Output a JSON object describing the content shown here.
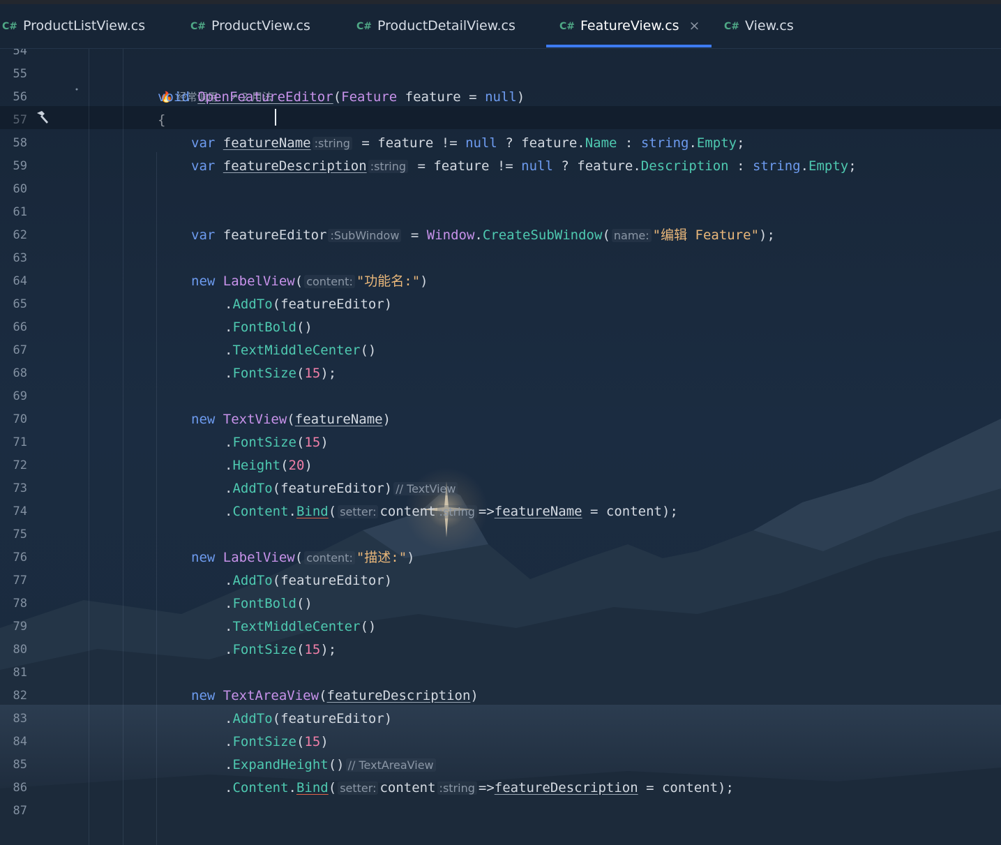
{
  "tabs": [
    {
      "icon": "C#",
      "label": "ProductListView.cs",
      "active": false
    },
    {
      "icon": "C#",
      "label": "ProductView.cs",
      "active": false
    },
    {
      "icon": "C#",
      "label": "ProductDetailView.cs",
      "active": false
    },
    {
      "icon": "C#",
      "label": "FeatureView.cs",
      "active": true,
      "close": "×"
    },
    {
      "icon": "C#",
      "label": "View.cs",
      "active": false
    }
  ],
  "editor": {
    "codelens": {
      "usage_hint": "经常调用",
      "usages": "2 用法"
    },
    "line_numbers": [
      "54",
      "55",
      "56",
      "57",
      "58",
      "59",
      "60",
      "61",
      "62",
      "63",
      "64",
      "65",
      "66",
      "67",
      "68",
      "69",
      "70",
      "71",
      "72",
      "73",
      "74",
      "75",
      "76",
      "77",
      "78",
      "79",
      "80",
      "81",
      "82",
      "83",
      "84",
      "85",
      "86",
      "87"
    ],
    "lines": [
      {
        "line": 56,
        "indent": 0,
        "tokens": [
          {
            "t": "void",
            "c": "kw"
          },
          {
            "t": " "
          },
          {
            "t": "OpenFeatureEditor",
            "c": "fn und"
          },
          {
            "t": "("
          },
          {
            "t": "Feature",
            "c": "typ"
          },
          {
            "t": " feature = "
          },
          {
            "t": "null",
            "c": "kw"
          },
          {
            "t": ")"
          }
        ]
      },
      {
        "line": 57,
        "indent": 0,
        "tokens": [
          {
            "t": "{"
          }
        ]
      },
      {
        "line": 58,
        "indent": 1,
        "tokens": [
          {
            "t": "var",
            "c": "kw"
          },
          {
            "t": " "
          },
          {
            "t": "featureName",
            "c": "und"
          },
          {
            "t": ":string",
            "c": "hint"
          },
          {
            "t": " = feature != "
          },
          {
            "t": "null",
            "c": "kw"
          },
          {
            "t": " ? feature."
          },
          {
            "t": "Name",
            "c": "prop"
          },
          {
            "t": " : "
          },
          {
            "t": "string",
            "c": "kw"
          },
          {
            "t": "."
          },
          {
            "t": "Empty",
            "c": "prop"
          },
          {
            "t": ";"
          }
        ]
      },
      {
        "line": 59,
        "indent": 1,
        "tokens": [
          {
            "t": "var",
            "c": "kw"
          },
          {
            "t": " "
          },
          {
            "t": "featureDescription",
            "c": "und"
          },
          {
            "t": ":string",
            "c": "hint"
          },
          {
            "t": " = feature != "
          },
          {
            "t": "null",
            "c": "kw"
          },
          {
            "t": " ? feature."
          },
          {
            "t": "Description",
            "c": "prop"
          },
          {
            "t": " : "
          },
          {
            "t": "string",
            "c": "kw"
          },
          {
            "t": "."
          },
          {
            "t": "Empty",
            "c": "prop"
          },
          {
            "t": ";"
          }
        ]
      },
      {
        "line": 62,
        "indent": 1,
        "tokens": [
          {
            "t": "var",
            "c": "kw"
          },
          {
            "t": " featureEditor"
          },
          {
            "t": ":SubWindow",
            "c": "hint"
          },
          {
            "t": " = "
          },
          {
            "t": "Window",
            "c": "typ"
          },
          {
            "t": "."
          },
          {
            "t": "CreateSubWindow",
            "c": "meth"
          },
          {
            "t": "("
          },
          {
            "t": "name:",
            "c": "hint"
          },
          {
            "t": "\"编辑 Feature\"",
            "c": "str"
          },
          {
            "t": ");"
          }
        ]
      },
      {
        "line": 64,
        "indent": 1,
        "tokens": [
          {
            "t": "new",
            "c": "kw"
          },
          {
            "t": " "
          },
          {
            "t": "LabelView",
            "c": "typ"
          },
          {
            "t": "("
          },
          {
            "t": "content:",
            "c": "hint"
          },
          {
            "t": "\"功能名:\"",
            "c": "str"
          },
          {
            "t": ")"
          }
        ]
      },
      {
        "line": 65,
        "indent": 2,
        "tokens": [
          {
            "t": "."
          },
          {
            "t": "AddTo",
            "c": "meth"
          },
          {
            "t": "(featureEditor)"
          }
        ]
      },
      {
        "line": 66,
        "indent": 2,
        "tokens": [
          {
            "t": "."
          },
          {
            "t": "FontBold",
            "c": "meth"
          },
          {
            "t": "()"
          }
        ]
      },
      {
        "line": 67,
        "indent": 2,
        "tokens": [
          {
            "t": "."
          },
          {
            "t": "TextMiddleCenter",
            "c": "meth"
          },
          {
            "t": "()"
          }
        ]
      },
      {
        "line": 68,
        "indent": 2,
        "tokens": [
          {
            "t": "."
          },
          {
            "t": "FontSize",
            "c": "meth"
          },
          {
            "t": "("
          },
          {
            "t": "15",
            "c": "num"
          },
          {
            "t": ");"
          }
        ]
      },
      {
        "line": 70,
        "indent": 1,
        "tokens": [
          {
            "t": "new",
            "c": "kw"
          },
          {
            "t": " "
          },
          {
            "t": "TextView",
            "c": "typ"
          },
          {
            "t": "("
          },
          {
            "t": "featureName",
            "c": "und"
          },
          {
            "t": ")"
          }
        ]
      },
      {
        "line": 71,
        "indent": 2,
        "tokens": [
          {
            "t": "."
          },
          {
            "t": "FontSize",
            "c": "meth"
          },
          {
            "t": "("
          },
          {
            "t": "15",
            "c": "num"
          },
          {
            "t": ")"
          }
        ]
      },
      {
        "line": 72,
        "indent": 2,
        "tokens": [
          {
            "t": "."
          },
          {
            "t": "Height",
            "c": "meth"
          },
          {
            "t": "("
          },
          {
            "t": "20",
            "c": "num"
          },
          {
            "t": ")"
          }
        ]
      },
      {
        "line": 73,
        "indent": 2,
        "tokens": [
          {
            "t": "."
          },
          {
            "t": "AddTo",
            "c": "meth"
          },
          {
            "t": "(featureEditor)"
          },
          {
            "t": "// TextView",
            "c": "hint"
          }
        ]
      },
      {
        "line": 74,
        "indent": 2,
        "tokens": [
          {
            "t": "."
          },
          {
            "t": "Content",
            "c": "prop"
          },
          {
            "t": "."
          },
          {
            "t": "Bind",
            "c": "meth red-und"
          },
          {
            "t": "("
          },
          {
            "t": "setter:",
            "c": "hint"
          },
          {
            "t": "content"
          },
          {
            "t": ":string",
            "c": "hint"
          },
          {
            "t": "=>"
          },
          {
            "t": "featureName",
            "c": "und"
          },
          {
            "t": " = content);"
          }
        ]
      },
      {
        "line": 76,
        "indent": 1,
        "tokens": [
          {
            "t": "new",
            "c": "kw"
          },
          {
            "t": " "
          },
          {
            "t": "LabelView",
            "c": "typ"
          },
          {
            "t": "("
          },
          {
            "t": "content:",
            "c": "hint"
          },
          {
            "t": "\"描述:\"",
            "c": "str"
          },
          {
            "t": ")"
          }
        ]
      },
      {
        "line": 77,
        "indent": 2,
        "tokens": [
          {
            "t": "."
          },
          {
            "t": "AddTo",
            "c": "meth"
          },
          {
            "t": "(featureEditor)"
          }
        ]
      },
      {
        "line": 78,
        "indent": 2,
        "tokens": [
          {
            "t": "."
          },
          {
            "t": "FontBold",
            "c": "meth"
          },
          {
            "t": "()"
          }
        ]
      },
      {
        "line": 79,
        "indent": 2,
        "tokens": [
          {
            "t": "."
          },
          {
            "t": "TextMiddleCenter",
            "c": "meth"
          },
          {
            "t": "()"
          }
        ]
      },
      {
        "line": 80,
        "indent": 2,
        "tokens": [
          {
            "t": "."
          },
          {
            "t": "FontSize",
            "c": "meth"
          },
          {
            "t": "("
          },
          {
            "t": "15",
            "c": "num"
          },
          {
            "t": ");"
          }
        ]
      },
      {
        "line": 82,
        "indent": 1,
        "tokens": [
          {
            "t": "new",
            "c": "kw"
          },
          {
            "t": " "
          },
          {
            "t": "TextAreaView",
            "c": "typ"
          },
          {
            "t": "("
          },
          {
            "t": "featureDescription",
            "c": "und"
          },
          {
            "t": ")"
          }
        ]
      },
      {
        "line": 83,
        "indent": 2,
        "tokens": [
          {
            "t": "."
          },
          {
            "t": "AddTo",
            "c": "meth"
          },
          {
            "t": "(featureEditor)"
          }
        ]
      },
      {
        "line": 84,
        "indent": 2,
        "tokens": [
          {
            "t": "."
          },
          {
            "t": "FontSize",
            "c": "meth"
          },
          {
            "t": "("
          },
          {
            "t": "15",
            "c": "num"
          },
          {
            "t": ")"
          }
        ]
      },
      {
        "line": 85,
        "indent": 2,
        "tokens": [
          {
            "t": "."
          },
          {
            "t": "ExpandHeight",
            "c": "meth"
          },
          {
            "t": "()"
          },
          {
            "t": "// TextAreaView",
            "c": "hint"
          }
        ]
      },
      {
        "line": 86,
        "indent": 2,
        "tokens": [
          {
            "t": "."
          },
          {
            "t": "Content",
            "c": "prop"
          },
          {
            "t": "."
          },
          {
            "t": "Bind",
            "c": "meth red-und"
          },
          {
            "t": "("
          },
          {
            "t": "setter:",
            "c": "hint"
          },
          {
            "t": "content"
          },
          {
            "t": ":string",
            "c": "hint"
          },
          {
            "t": "=>"
          },
          {
            "t": "featureDescription",
            "c": "und"
          },
          {
            "t": " = content);"
          }
        ]
      }
    ]
  }
}
